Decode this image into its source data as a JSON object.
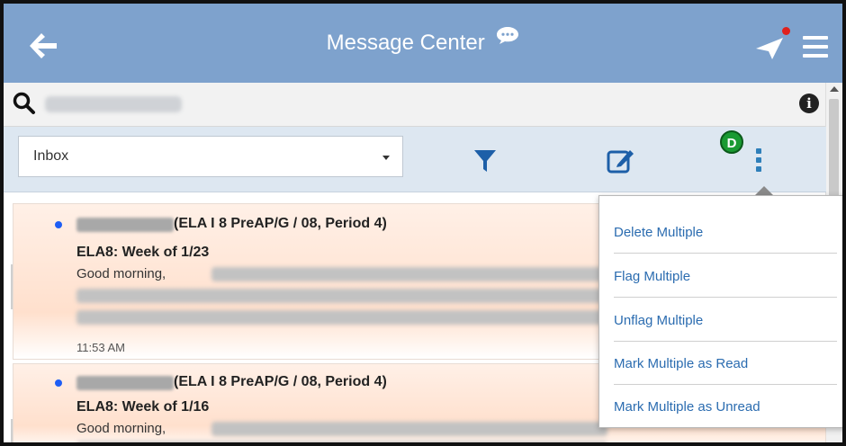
{
  "header": {
    "title": "Message Center",
    "notification_color": "#e0211d"
  },
  "search": {
    "placeholder": "",
    "icon": "search-icon"
  },
  "toolbar": {
    "folder": "Inbox",
    "step_badge": "D"
  },
  "dropdown": {
    "items": [
      "Delete Multiple",
      "Flag Multiple",
      "Unflag Multiple",
      "Mark Multiple as Read",
      "Mark Multiple as Unread"
    ]
  },
  "messages": [
    {
      "course": "(ELA I 8 PreAP/G / 08, Period 4)",
      "subject": "ELA8: Week of 1/23",
      "greeting": "Good morning,",
      "time": "11:53 AM"
    },
    {
      "course": "(ELA I 8 PreAP/G / 08, Period 4)",
      "subject": "ELA8: Week of 1/16",
      "greeting": "Good morning,",
      "time": ""
    }
  ],
  "colors": {
    "header_bg": "#7ea2cd",
    "toolbar_bg": "#dde7f1",
    "link_blue": "#2b6cb0",
    "badge_green": "#1a9a32",
    "unread_dot": "#1e5ef5"
  }
}
